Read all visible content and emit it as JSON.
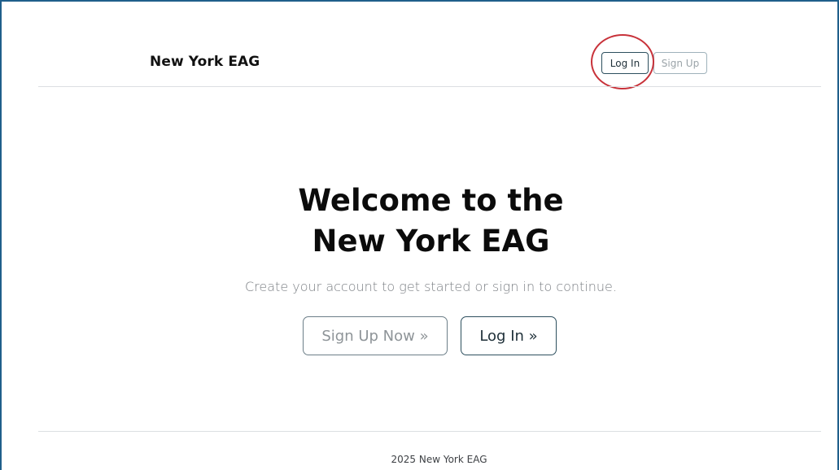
{
  "header": {
    "brand": "New York EAG",
    "login_label": "Log In",
    "signup_label": "Sign Up"
  },
  "hero": {
    "title_line1": "Welcome to the",
    "title_line2": "New York EAG",
    "subtitle": "Create your account to get started or sign in to continue.",
    "signup_cta": "Sign Up Now »",
    "login_cta": "Log In »"
  },
  "footer": {
    "text": "2025 New York EAG"
  },
  "colors": {
    "frame_border": "#1f5f8b",
    "highlight_ring": "#c8323a",
    "primary_border": "#2d4f5e",
    "muted_border": "#9fb2bb"
  }
}
